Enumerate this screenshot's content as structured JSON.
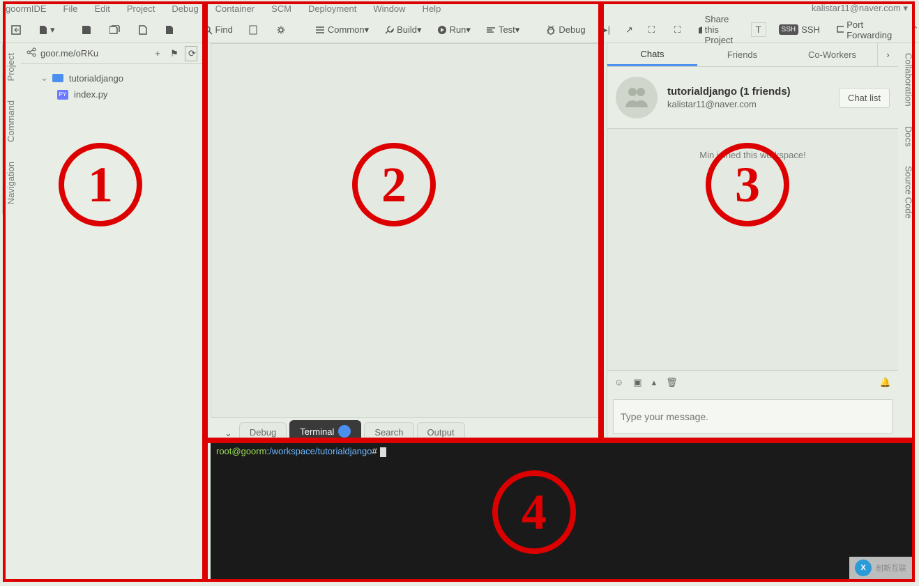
{
  "menubar": {
    "brand": "goormIDE",
    "items": [
      "File",
      "Edit",
      "Project",
      "Debug",
      "Container",
      "SCM",
      "Deployment",
      "Window",
      "Help"
    ],
    "user": "kalistar11@naver.com"
  },
  "toolbar": {
    "find": "Find",
    "common": "Common",
    "build": "Build",
    "run": "Run",
    "test": "Test",
    "debug": "Debug",
    "share": "Share this Project",
    "ssh": "SSH",
    "port": "Port Forwarding"
  },
  "left_tabs": [
    "Project",
    "Command",
    "Navigation"
  ],
  "right_tabs": [
    "Collaboration",
    "Docs",
    "Source Code"
  ],
  "project": {
    "url": "goor.me/oRKu",
    "folder": "tutorialdjango",
    "file": "index.py",
    "py_badge": "PY"
  },
  "bottom_tabs": {
    "debug": "Debug",
    "terminal": "Terminal",
    "search": "Search",
    "output": "Output"
  },
  "terminal": {
    "prompt_user": "root@goorm",
    "prompt_sep": ":",
    "prompt_path": "/workspace/tutorialdjango",
    "prompt_end": "#"
  },
  "collab": {
    "tabs": {
      "chats": "Chats",
      "friends": "Friends",
      "coworkers": "Co-Workers"
    },
    "user_name": "tutorialdjango (1 friends)",
    "user_email": "kalistar11@naver.com",
    "chat_list_btn": "Chat list",
    "sys_msg": "Min joined this workspace!",
    "input_placeholder": "Type your message."
  },
  "annotations": {
    "n1": "1",
    "n2": "2",
    "n3": "3",
    "n4": "4"
  },
  "watermark": {
    "logo": "X",
    "text": "创新互联"
  }
}
